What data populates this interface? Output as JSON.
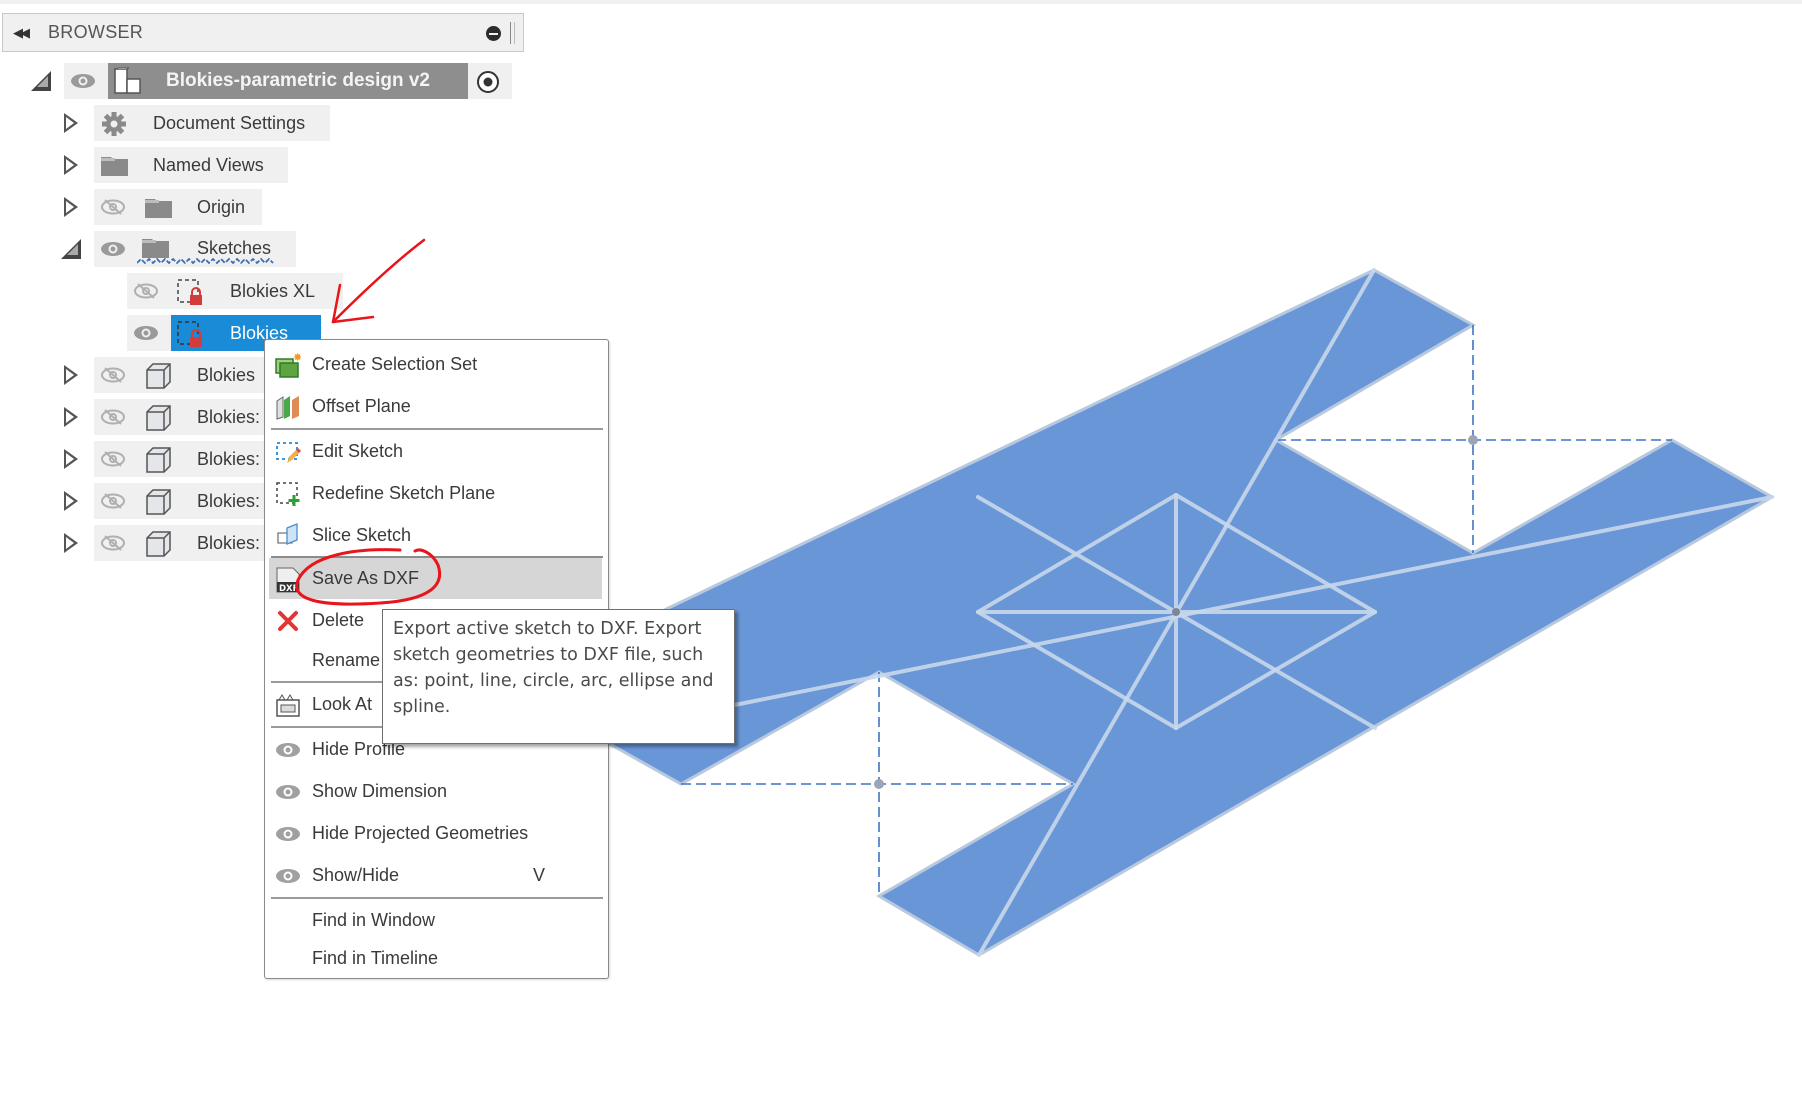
{
  "browser": {
    "title": "BROWSER",
    "collapse_icon": "double-chevron-left-icon",
    "minimize_icon": "minus-circle-icon"
  },
  "tree": {
    "root": {
      "label": "Blokies-parametric design v2",
      "expanded": true,
      "visible": true,
      "icon": "component-icon",
      "activate_icon": "radio-active-icon"
    },
    "items": [
      {
        "label": "Document Settings",
        "expanded": false,
        "icon": "gear-icon",
        "has_eye": false
      },
      {
        "label": "Named Views",
        "expanded": false,
        "icon": "folder-icon",
        "has_eye": false
      },
      {
        "label": "Origin",
        "expanded": false,
        "icon": "folder-icon",
        "has_eye": true,
        "visible": false
      },
      {
        "label": "Sketches",
        "expanded": true,
        "icon": "folder-icon",
        "has_eye": true,
        "visible": true,
        "children": [
          {
            "label": "Blokies XL",
            "icon": "sketch-icon",
            "visible": false,
            "selected": false
          },
          {
            "label": "Blokies",
            "icon": "sketch-icon",
            "visible": true,
            "selected": true
          }
        ]
      },
      {
        "label": "Blokies",
        "expanded": false,
        "icon": "body-icon",
        "visible": false
      },
      {
        "label": "Blokies:",
        "expanded": false,
        "icon": "body-icon",
        "visible": false
      },
      {
        "label": "Blokies:",
        "expanded": false,
        "icon": "body-icon",
        "visible": false
      },
      {
        "label": "Blokies:",
        "expanded": false,
        "icon": "body-icon",
        "visible": false
      },
      {
        "label": "Blokies:",
        "expanded": false,
        "icon": "body-icon",
        "visible": false
      }
    ]
  },
  "context_menu": {
    "items": [
      {
        "label": "Create Selection Set",
        "icon": "selection-set-icon"
      },
      {
        "label": "Offset Plane",
        "icon": "offset-plane-icon"
      },
      {
        "separator": true
      },
      {
        "label": "Edit Sketch",
        "icon": "edit-sketch-icon"
      },
      {
        "label": "Redefine Sketch Plane",
        "icon": "redefine-sketch-plane-icon"
      },
      {
        "label": "Slice Sketch",
        "icon": "slice-sketch-icon"
      },
      {
        "label": "Save As DXF",
        "icon": "dxf-file-icon",
        "highlighted": true
      },
      {
        "label": "Delete",
        "icon": "delete-x-icon"
      },
      {
        "label": "Rename",
        "icon": ""
      },
      {
        "separator": true
      },
      {
        "label": "Look At",
        "icon": "look-at-icon"
      },
      {
        "separator": true
      },
      {
        "label": "Hide Profile",
        "icon": "eye-icon"
      },
      {
        "label": "Show Dimension",
        "icon": "eye-icon"
      },
      {
        "label": "Hide Projected Geometries",
        "icon": "eye-icon"
      },
      {
        "label": "Show/Hide",
        "icon": "eye-icon",
        "shortcut": "V"
      },
      {
        "separator": true
      },
      {
        "label": "Find in Window",
        "icon": ""
      },
      {
        "label": "Find in Timeline",
        "icon": ""
      }
    ]
  },
  "tooltip": {
    "text": "Export active sketch to DXF. Export sketch geometries to DXF file, such as: point, line, circle, arc, ellipse and spline."
  },
  "colors": {
    "sketch_fill": "#6896d6",
    "sketch_line": "#c8d8ec",
    "selection": "#1a8bd6",
    "annotation": "#e8161b",
    "menu_highlight": "#d6d6d6"
  }
}
